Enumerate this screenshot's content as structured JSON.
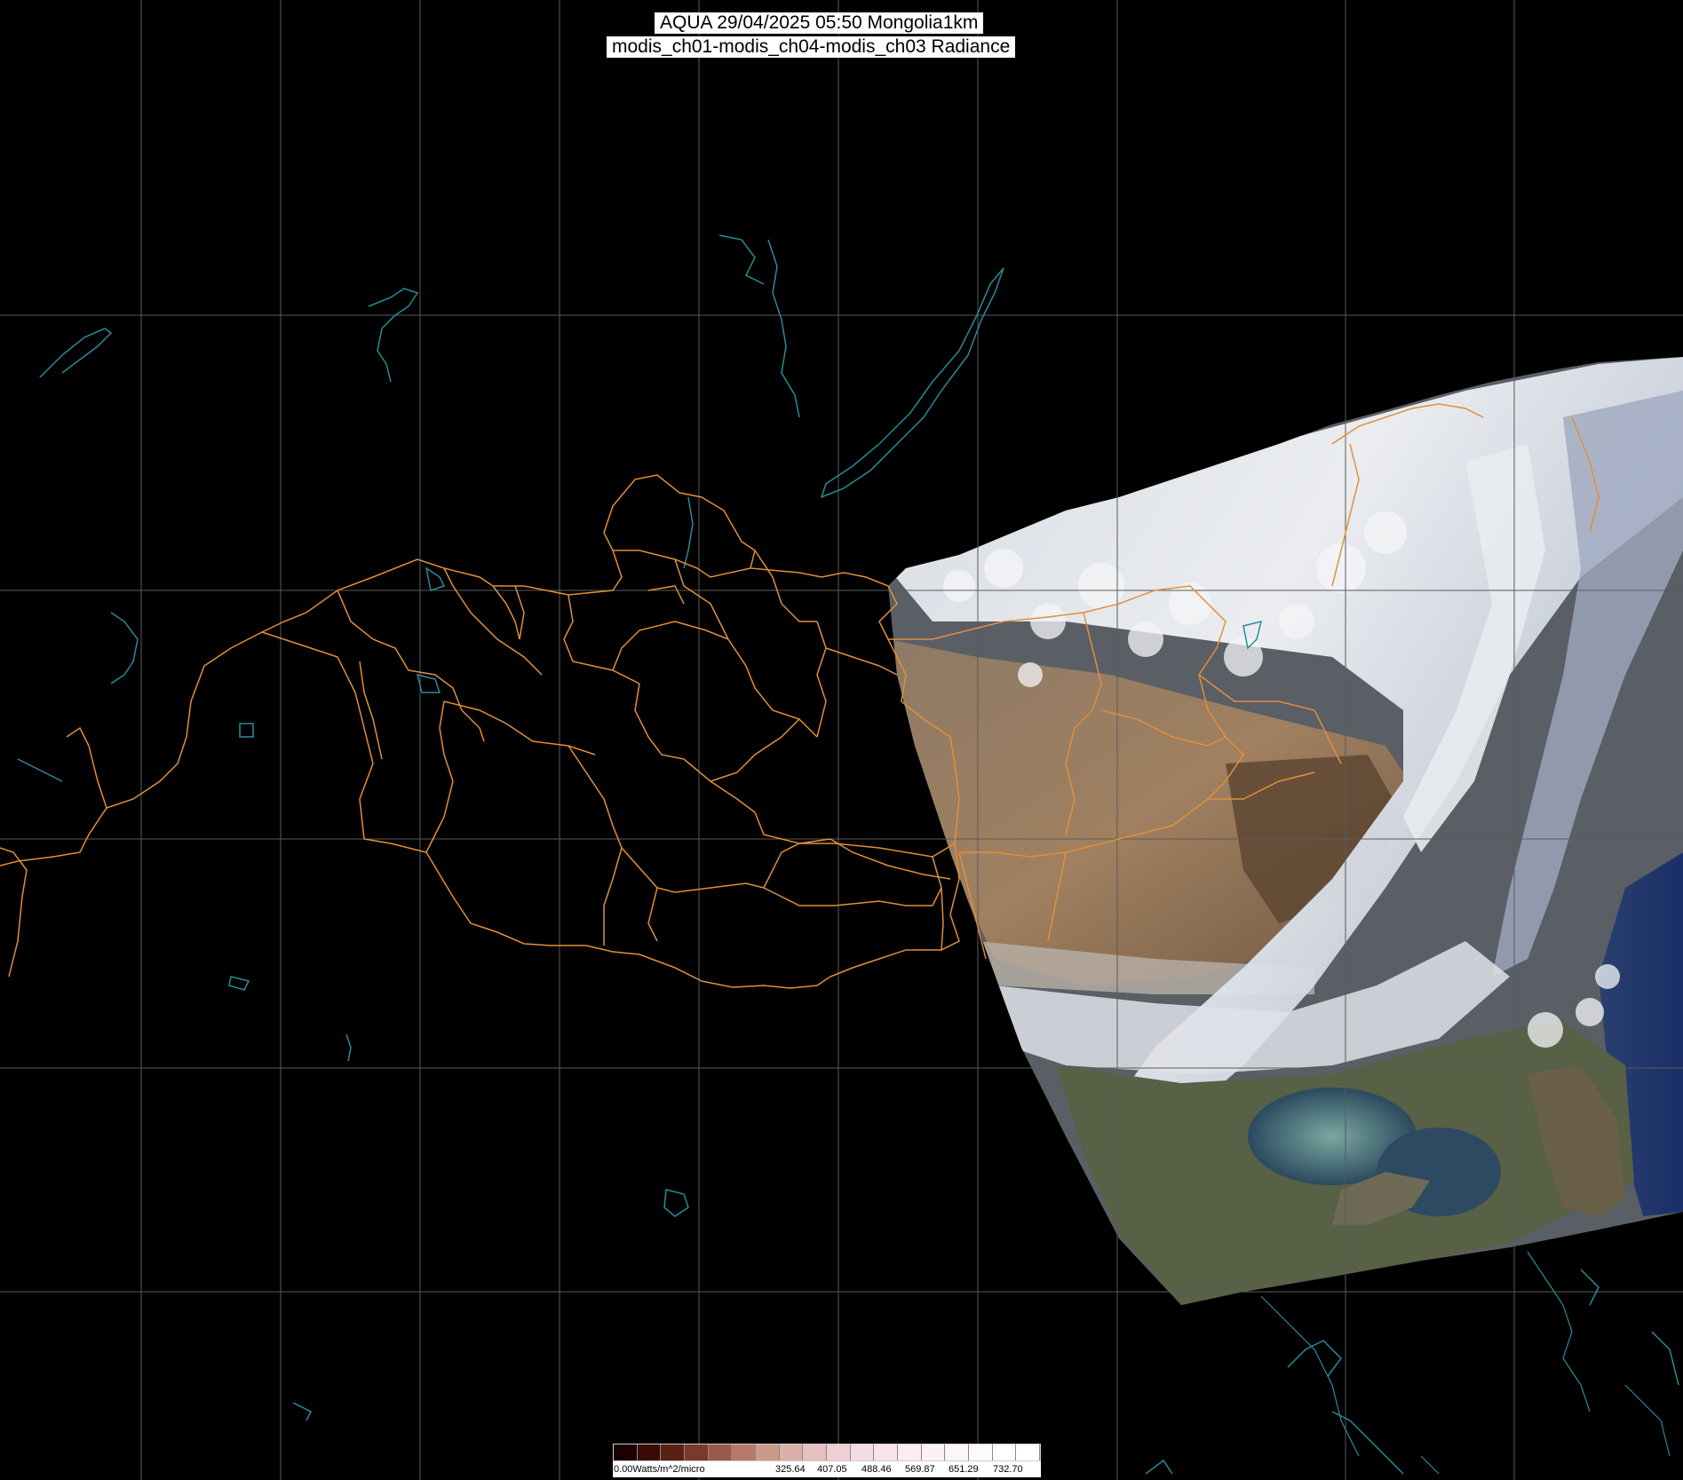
{
  "title": {
    "line1": "AQUA 29/04/2025 05:50 Mongolia1km",
    "line2": "modis_ch01-modis_ch04-modis_ch03 Radiance"
  },
  "colors": {
    "background": "#000000",
    "grid": "#5a5a5a",
    "border": "#e0903a",
    "water": "#2a8a9a"
  },
  "colorbar": {
    "labels": [
      "0.00Watts/m^2/micro",
      "325.64",
      "407.05",
      "488.46",
      "569.87",
      "651.29",
      "732.70"
    ],
    "colors": [
      "#1a0000",
      "#3a0a05",
      "#5a2015",
      "#7a3a2a",
      "#9a5a4a",
      "#b57a6a",
      "#cc9a8a",
      "#dbb0a8",
      "#e6c0c0",
      "#efd0d4",
      "#f5dce2",
      "#f7e4ea",
      "#faecf0",
      "#fcf2f5",
      "#fdf6f8",
      "#fefafb",
      "#ffffff",
      "#ffffff"
    ]
  }
}
